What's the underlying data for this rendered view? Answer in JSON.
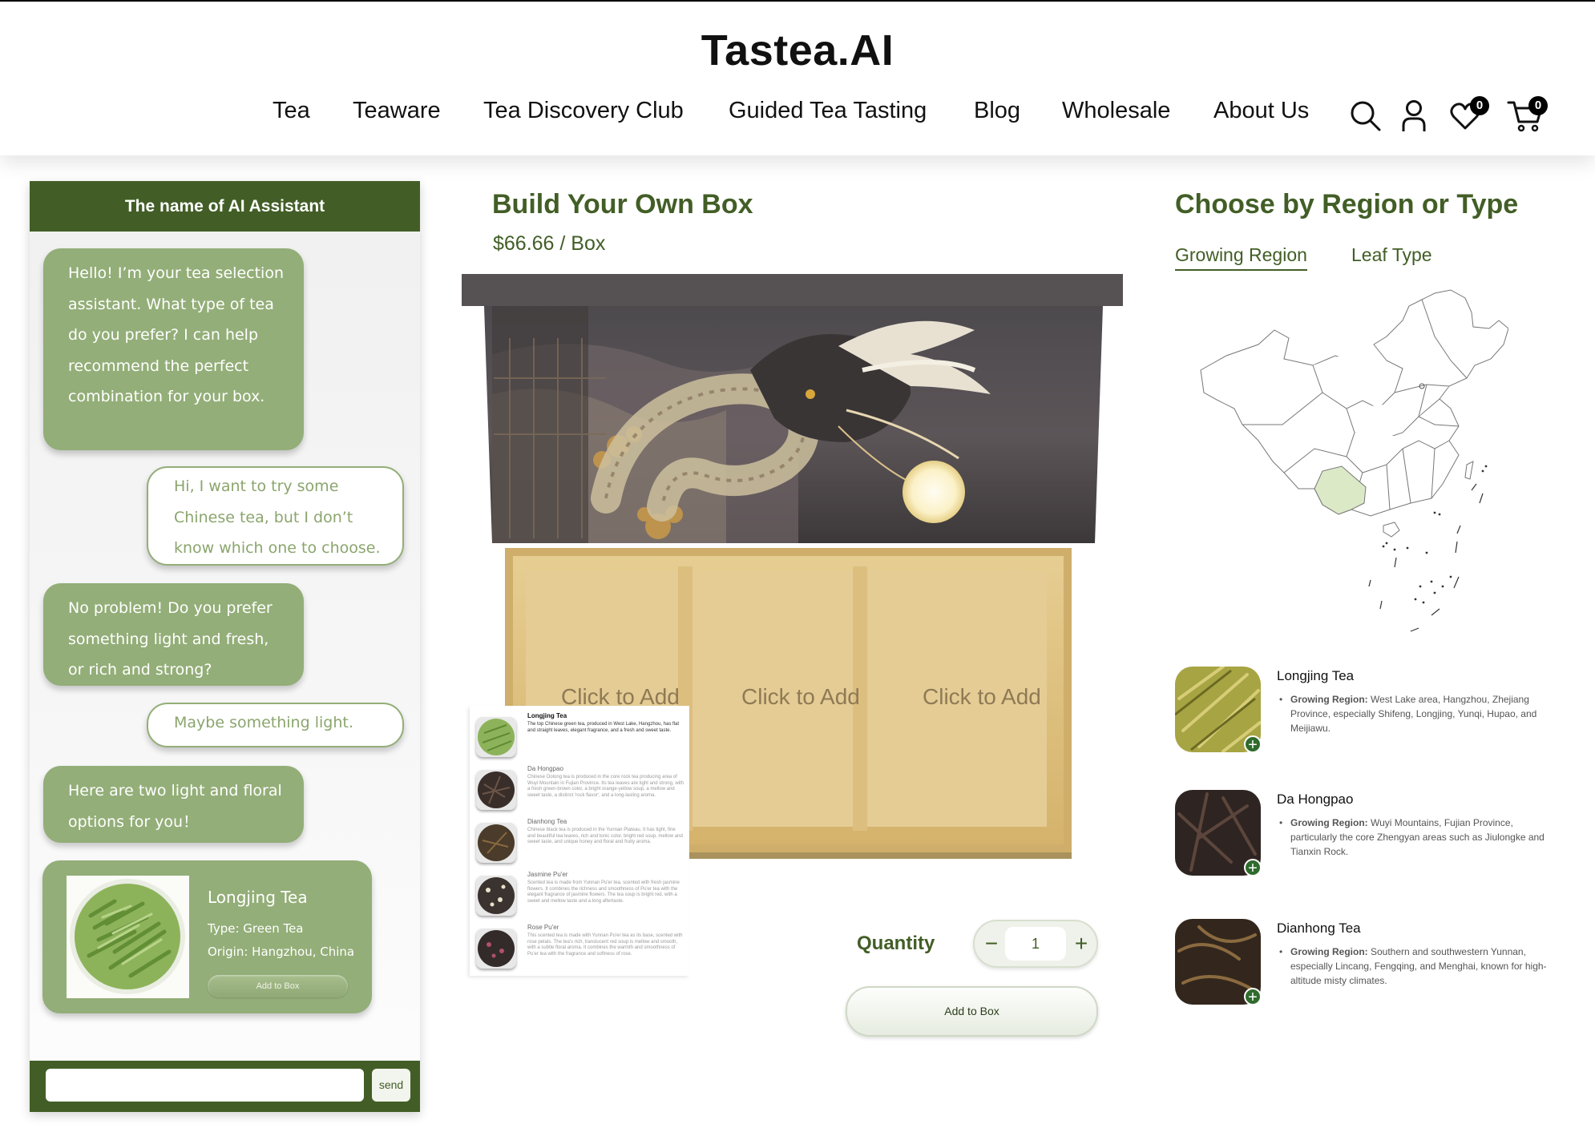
{
  "brand": "Tastea.AI",
  "nav": [
    "Tea",
    "Teaware",
    "Tea Discovery Club",
    "Guided Tea Tasting",
    "Blog",
    "Wholesale",
    "About Us"
  ],
  "header_icons": {
    "search": "search-icon",
    "account": "user-icon",
    "wishlist": "heart-icon",
    "wishlist_count": "0",
    "cart": "cart-icon",
    "cart_count": "0"
  },
  "chat": {
    "title": "The name of AI Assistant",
    "messages": [
      {
        "from": "assistant",
        "text": "Hello! I’m your tea selection assistant. What type of tea do you prefer? I can help recommend the perfect combination for your box."
      },
      {
        "from": "user",
        "text": "Hi, I want to try some Chinese tea, but I don’t know which one to choose."
      },
      {
        "from": "assistant",
        "text": "No problem! Do you prefer something light and fresh, or rich and strong?"
      },
      {
        "from": "user",
        "text": "Maybe something light."
      },
      {
        "from": "assistant",
        "text": "Here are two light and floral options for you！"
      }
    ],
    "card": {
      "name": "Longjing Tea",
      "type": "Type: Green Tea",
      "origin": "Origin: Hangzhou, China",
      "button": "Add to Box"
    },
    "input_placeholder": "",
    "send_label": "send"
  },
  "builder": {
    "title": "Build Your Own Box",
    "price": "$66.66 / Box",
    "slots": [
      "Click to Add",
      "Click to Add",
      "Click to Add"
    ],
    "popup": [
      {
        "name": "Longjing Tea",
        "desc": "The top Chinese green tea, produced in West Lake, Hangzhou, has flat and straight leaves, elegant fragrance, and a fresh and sweet taste."
      },
      {
        "name": "Da Hongpao",
        "desc": "Chinese Oolong tea is produced in the core rock tea producing area of Wuyi Mountain in Fujian Province. Its tea leaves are tight and strong, with a fresh green-brown color, a bright orange-yellow soup, a mellow and sweet taste, a distinct 'rock flavor', and a long-lasting aroma."
      },
      {
        "name": "Dianhong Tea",
        "desc": "Chinese black tea is produced in the Yunnan Plateau. It has tight, fine and beautiful tea leaves, rich and tonic color, bright red soup, mellow and sweet taste, and unique honey and floral and fruity aroma."
      },
      {
        "name": "Jasmine Pu'er",
        "desc": "Scented tea is made from Yunnan Pu'er tea, scented with fresh jasmine flowers. It combines the richness and smoothness of Pu'er tea with the elegant fragrance of jasmine flowers. The tea soup is bright red, with a sweet and mellow taste and a long aftertaste."
      },
      {
        "name": "Rose Pu'er",
        "desc": "This scented tea is made with Yunnan Pu'er tea as its base, scented with rose petals. The tea's rich, translucent red soup is mellow and smooth, with a subtle floral aroma. It combines the warmth and smoothness of Pu'er tea with the fragrance and softness of rose."
      }
    ],
    "quantity_label": "Quantity",
    "quantity": "1",
    "add_button": "Add to Box"
  },
  "region": {
    "title": "Choose by Region or Type",
    "tabs": [
      "Growing Region",
      "Leaf Type"
    ],
    "active_tab": "Growing Region",
    "teas": [
      {
        "name": "Longjing Tea",
        "label": "Growing Region:",
        "text": "West Lake area, Hangzhou, Zhejiang Province, especially Shifeng, Longjing, Yunqi, Hupao, and Meijiawu."
      },
      {
        "name": "Da Hongpao",
        "label": "Growing Region:",
        "text": "Wuyi Mountains, Fujian Province, particularly the core Zhengyan areas such as Jiulongke and Tianxin Rock."
      },
      {
        "name": "Dianhong Tea",
        "label": "Growing Region:",
        "text": "Southern and southwestern Yunnan, especially Lincang, Fengqing, and Menghai, known for high-altitude misty climates."
      }
    ]
  },
  "colors": {
    "brand_green": "#425e26",
    "bubble_green": "#93ae78",
    "highlight_region": "#dce9c6"
  }
}
